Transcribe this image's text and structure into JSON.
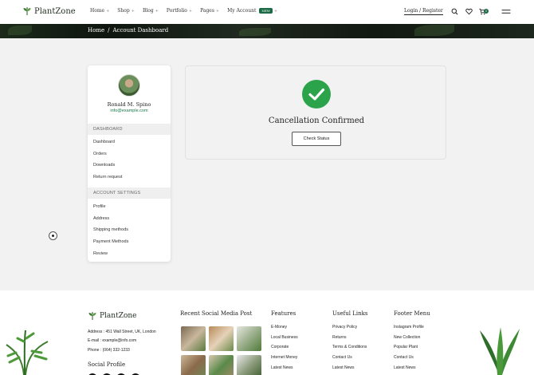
{
  "header": {
    "brand": "PlantZone",
    "nav": [
      {
        "label": "Home",
        "caret": "+"
      },
      {
        "label": "Shop",
        "caret": "+"
      },
      {
        "label": "Blog",
        "caret": "+"
      },
      {
        "label": "Portfolio",
        "caret": "+"
      },
      {
        "label": "Pages",
        "caret": "+"
      },
      {
        "label": "My Account",
        "badge": "NEW",
        "caret": "+"
      }
    ],
    "login": "Login / Register",
    "cart_count": "0",
    "icons": [
      "search-icon",
      "heart-icon",
      "cart-icon",
      "menu-icon"
    ]
  },
  "breadcrumb": {
    "home": "Home",
    "sep": "/",
    "current": "Account Dashboard"
  },
  "sidebar": {
    "name": "Ronald M. Spino",
    "email": "info@example.com",
    "section1": "DASHBOARD",
    "items1": [
      "Dashboard",
      "Orders",
      "Downloads",
      "Return request"
    ],
    "section2": "ACCOUNT SETTINGS",
    "items2": [
      "Profile",
      "Address",
      "Shipping methods",
      "Payment Methods",
      "Review"
    ]
  },
  "main": {
    "title": "Cancellation Confirmed",
    "button": "Check Status"
  },
  "footer": {
    "brand": "PlantZone",
    "address": "Address : 451 Wall Street, UK, London",
    "email": "E-mail : example@info.com",
    "phone": "Phone : (064) 332-1233",
    "social_heading": "Social Profile",
    "social_media_heading": "Recent Social Media Post",
    "columns": [
      {
        "title": "Features",
        "links": [
          "E-Money",
          "Local Business",
          "Corporate",
          "Internet Money",
          "Latest News"
        ]
      },
      {
        "title": "Useful Links",
        "links": [
          "Privacy Policy",
          "Returns",
          "Terms & Conditions",
          "Contact Us",
          "Latest News"
        ]
      },
      {
        "title": "Footer Menu",
        "links": [
          "Instagram Profile",
          "New Collection",
          "Popular Plant",
          "Contact Us",
          "Latest News"
        ]
      }
    ]
  },
  "colors": {
    "accent": "#1a6b45",
    "success": "#2aa34a",
    "link": "#1a7a4a"
  }
}
